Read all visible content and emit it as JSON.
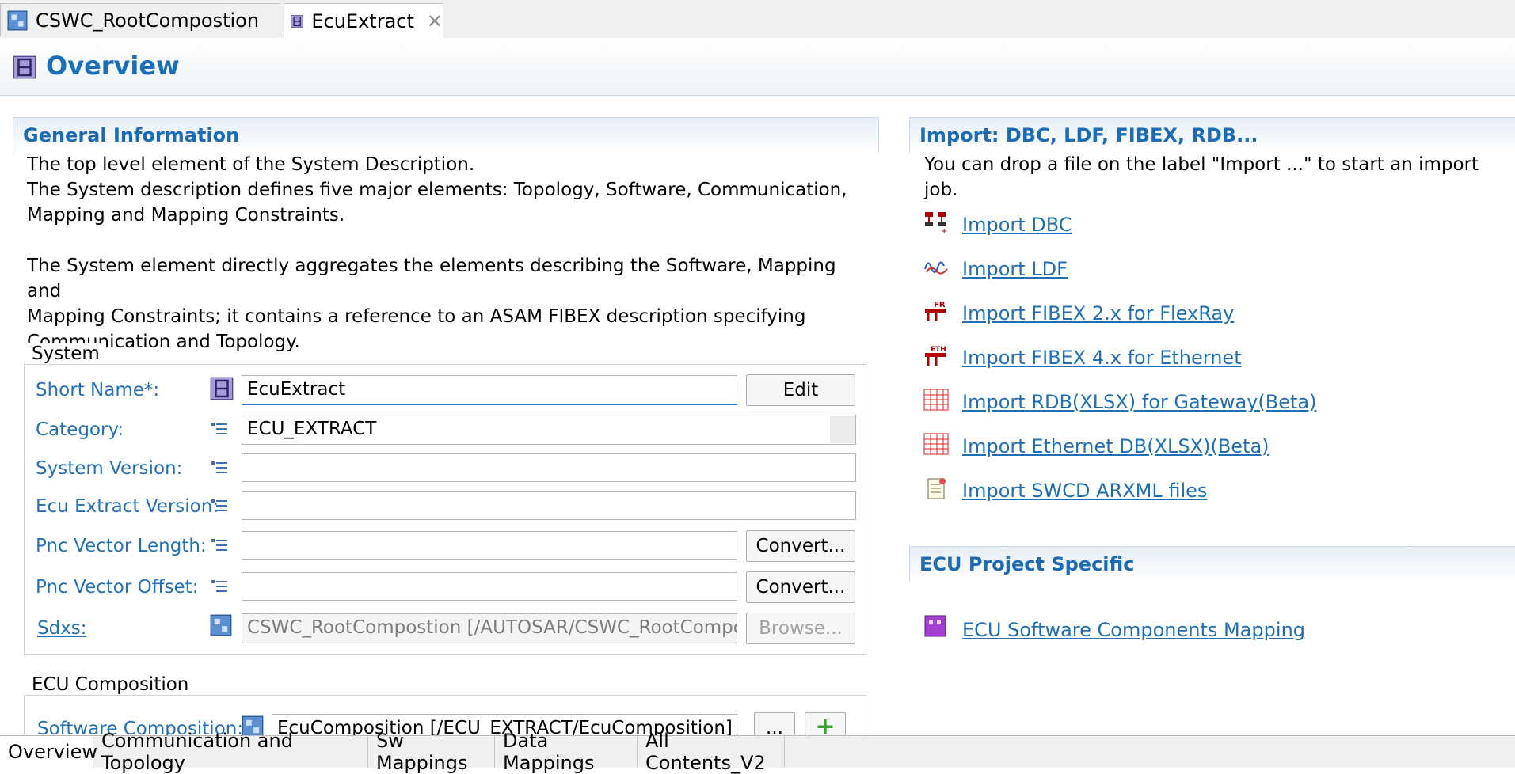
{
  "editor_tabs": [
    {
      "label": "CSWC_RootCompostion",
      "icon": "composition-icon"
    },
    {
      "label": "EcuExtract",
      "icon": "system-icon",
      "close": "✕"
    }
  ],
  "header": {
    "title": "Overview"
  },
  "general": {
    "title": "General Information",
    "lines": [
      "The top level element of the System Description.",
      "The System description defines five major elements: Topology, Software, Communication,",
      "Mapping and Mapping Constraints.",
      "The System element directly aggregates the elements describing the Software, Mapping and",
      "Mapping Constraints; it contains a reference to an ASAM FIBEX description specifying",
      "Communication and Topology."
    ]
  },
  "system": {
    "group_label": "System",
    "short_name": {
      "label": "Short Name*:",
      "value": "EcuExtract",
      "button": "Edit"
    },
    "category": {
      "label": "Category:",
      "value": "ECU_EXTRACT"
    },
    "system_version": {
      "label": "System Version:",
      "value": ""
    },
    "ecu_extract_version": {
      "label": "Ecu Extract Version:",
      "value": ""
    },
    "pnc_vector_length": {
      "label": "Pnc Vector Length:",
      "value": "",
      "button": "Convert..."
    },
    "pnc_vector_offset": {
      "label": "Pnc Vector Offset:",
      "value": "",
      "button": "Convert..."
    },
    "sdxs": {
      "label": "Sdxs:",
      "value": "CSWC_RootCompostion [/AUTOSAR/CSWC_RootCompostion]",
      "button": "Browse..."
    }
  },
  "ecu_composition": {
    "group_label": "ECU Composition",
    "software_composition": {
      "label": "Software Composition:",
      "value": "EcuComposition [/ECU_EXTRACT/EcuComposition] (/S",
      "button": "...",
      "add": "+"
    }
  },
  "import": {
    "title": "Import: DBC, LDF, FIBEX, RDB...",
    "description": "You can drop a file on the label \"Import ...\" to start an import job.",
    "links": [
      {
        "label": "Import DBC",
        "icon": "dbc-import-icon"
      },
      {
        "label": "Import LDF",
        "icon": "ldf-import-icon"
      },
      {
        "label": "Import FIBEX 2.x for FlexRay",
        "icon": "fibex-flexray-icon",
        "badge": "FR"
      },
      {
        "label": "Import FIBEX 4.x for Ethernet",
        "icon": "fibex-ethernet-icon",
        "badge": "ETH"
      },
      {
        "label": "Import RDB(XLSX) for Gateway(Beta)",
        "icon": "spreadsheet-icon"
      },
      {
        "label": "Import Ethernet DB(XLSX)(Beta)",
        "icon": "spreadsheet-icon"
      },
      {
        "label": "Import SWCD ARXML files",
        "icon": "arxml-file-icon"
      }
    ]
  },
  "ecu_project": {
    "title": "ECU Project Specific",
    "links": [
      {
        "label": "ECU Software Components Mapping",
        "icon": "component-mapping-icon"
      }
    ]
  },
  "bottom_tabs": [
    "Overview",
    "Communication and Topology",
    "Sw Mappings",
    "Data Mappings",
    "All Contents_V2"
  ],
  "colors": {
    "accent": "#1a6fb8",
    "link": "#1e6fb5"
  }
}
